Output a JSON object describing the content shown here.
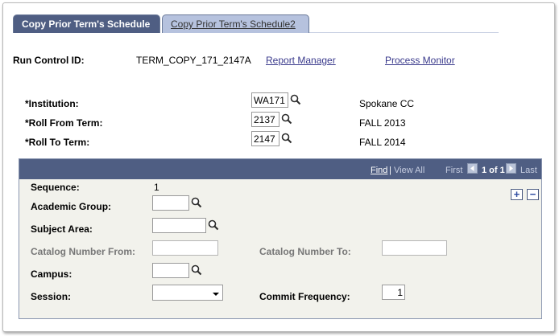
{
  "tabs": [
    {
      "label": "Copy Prior Term's Schedule"
    },
    {
      "label": "Copy Prior Term's Schedule2"
    }
  ],
  "run_control": {
    "label": "Run Control ID:",
    "value": "TERM_COPY_171_2147A",
    "report_manager": "Report Manager",
    "process_monitor": "Process Monitor"
  },
  "institution": {
    "label": "*Institution:",
    "value": "WA171",
    "description": "Spokane CC"
  },
  "roll_from": {
    "label": "*Roll From Term:",
    "value": "2137",
    "description": "FALL 2013"
  },
  "roll_to": {
    "label": "*Roll To Term:",
    "value": "2147",
    "description": "FALL 2014"
  },
  "grid": {
    "find": "Find",
    "separator": "|",
    "view_all": "View All",
    "first": "First",
    "page_info": "1 of 1",
    "last": "Last",
    "add_symbol": "+",
    "remove_symbol": "−"
  },
  "sequence": {
    "label": "Sequence:",
    "value": "1"
  },
  "academic_group": {
    "label": "Academic Group:",
    "value": ""
  },
  "subject_area": {
    "label": "Subject Area:",
    "value": ""
  },
  "catalog_from": {
    "label": "Catalog Number From:",
    "value": ""
  },
  "catalog_to": {
    "label": "Catalog Number To:",
    "value": ""
  },
  "campus": {
    "label": "Campus:",
    "value": ""
  },
  "session": {
    "label": "Session:",
    "value": ""
  },
  "commit_frequency": {
    "label": "Commit Frequency:",
    "value": "1"
  },
  "colors": {
    "tab_active": "#4f5e83",
    "tab_inactive": "#b6c2de",
    "link": "#3a3a8c",
    "grid_bg": "#f2f2ec"
  }
}
